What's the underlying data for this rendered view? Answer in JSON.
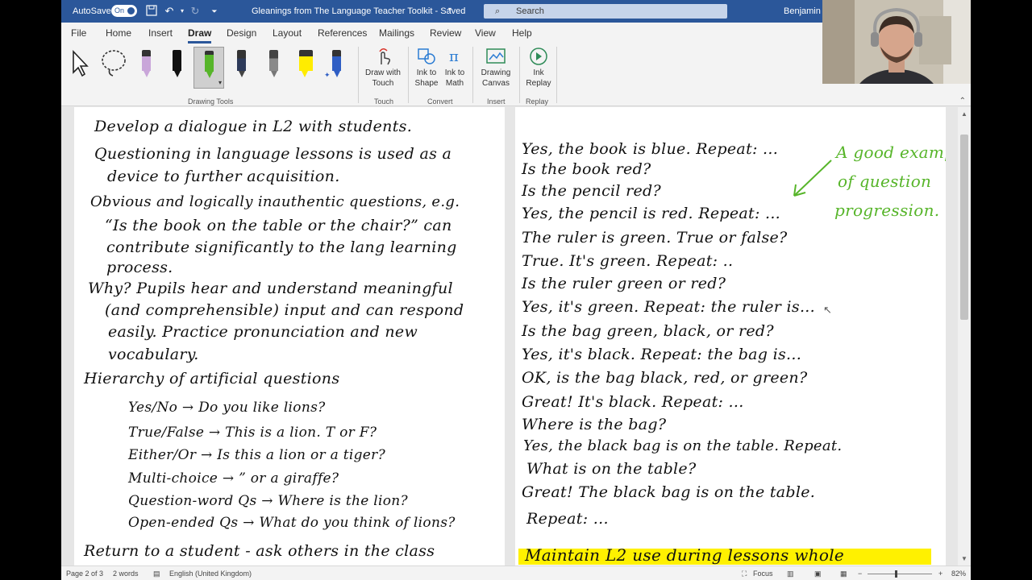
{
  "titlebar": {
    "autosave_label": "AutoSave",
    "autosave_state": "On",
    "doc_title": "Gleanings from The Language Teacher Toolkit  -  Saved",
    "search_placeholder": "Search",
    "user_name": "Benjamin L"
  },
  "tabs": [
    "File",
    "Home",
    "Insert",
    "Draw",
    "Design",
    "Layout",
    "References",
    "Mailings",
    "Review",
    "View",
    "Help"
  ],
  "active_tab": "Draw",
  "ribbon": {
    "drawing_tools_label": "Drawing Tools",
    "draw_with_touch": "Draw with Touch",
    "touch_label": "Touch",
    "ink_to_shape": "Ink to Shape",
    "ink_to_math": "Ink to Math",
    "convert_label": "Convert",
    "drawing_canvas": "Drawing Canvas",
    "insert_label": "Insert",
    "ink_replay": "Ink Replay",
    "replay_label": "Replay",
    "pen_colors": [
      "#c9a6d9",
      "#111111",
      "#57b52a",
      "#333333",
      "#777777",
      "#ffec00",
      "#2f5ec4"
    ]
  },
  "left_page": [
    "Develop a dialogue in L2 with students.",
    "Questioning in language lessons is used as a",
    "device to further acquisition.",
    "Obvious and logically inauthentic questions, e.g.",
    "“Is the book on the table or the chair?” can",
    "contribute significantly to the lang learning",
    "process.",
    "Why? Pupils hear and understand meaningful",
    "(and comprehensible) input and can respond",
    "easily. Practice pronunciation and new",
    "vocabulary.",
    "Hierarchy of artificial questions",
    "Yes/No  →  Do you like lions?",
    "True/False  →  This is a lion. T or F?",
    "Either/Or  →  Is this a lion or a tiger?",
    "Multi-choice  →      ”      or a giraffe?",
    "Question-word Qs  →  Where is the lion?",
    "Open-ended Qs  →  What do you think of lions?",
    "Return to a student - ask others in the class"
  ],
  "right_page": [
    "Yes, the book is blue. Repeat: ...",
    "Is the book red?",
    "Is the pencil red?",
    "Yes, the pencil is red. Repeat: ...",
    "The ruler is green. True or false?",
    "True. It's green. Repeat: ..",
    "Is the ruler green or red?",
    "Yes, it's green. Repeat: the ruler is...",
    "Is the bag green, black, or red?",
    "Yes, it's black. Repeat: the bag is...",
    "OK, is the bag black, red, or green?",
    "Great! It's black. Repeat: ...",
    "Where is the bag?",
    "Yes, the black bag is on the table. Repeat.",
    "What is on the table?",
    "Great! The black bag is on the table.",
    "Repeat: ...",
    "Maintain L2 use during lessons whole"
  ],
  "annotation": [
    "A good example",
    "of question",
    "progression."
  ],
  "status": {
    "page": "Page 2 of 3",
    "words": "2 words",
    "language": "English (United Kingdom)",
    "focus": "Focus",
    "zoom": "82%"
  }
}
